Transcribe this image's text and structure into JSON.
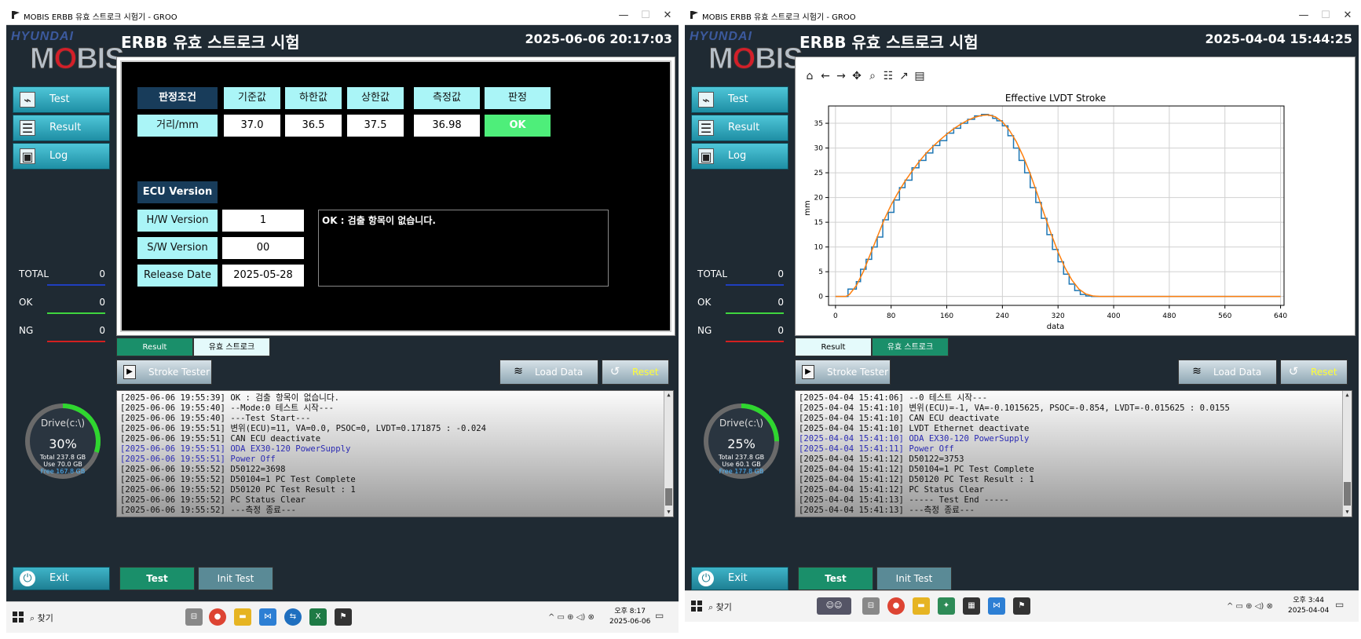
{
  "window_title": "MOBIS ERBB 유효 스트로크 시험기 - GROO",
  "window_controls": {
    "minimize": "—",
    "maximize": "☐",
    "close": "✕"
  },
  "logo": {
    "top": "HYUNDAI",
    "main_pre": "M",
    "main_o": "O",
    "main_post": "BIS"
  },
  "nav": {
    "test": "Test",
    "result": "Result",
    "log": "Log",
    "exit": "Exit"
  },
  "counters": {
    "total_label": "TOTAL",
    "ok_label": "OK",
    "ng_label": "NG",
    "colors": {
      "total": "#1f3fbf",
      "ok": "#3fd63f",
      "ng": "#d32020"
    }
  },
  "buttons": {
    "stroke_tester": "Stroke Tester",
    "load_data": "Load Data",
    "reset": "Reset",
    "init_test": "Init Test",
    "test": "Test"
  },
  "tabs": {
    "result": "Result",
    "stroke": "유효 스트로크"
  },
  "taskbar": {
    "search": "찾기"
  },
  "windows": [
    {
      "header_title": "ERBB 유효 스트로크 시험",
      "header_date": "2025-06-06 20:17:03",
      "counters": {
        "total": "0",
        "ok": "0",
        "ng": "0"
      },
      "drive": {
        "label": "Drive(c:\\)",
        "percent_text": "30%",
        "percent": 30,
        "total": "Total 237.8 GB",
        "use": "Use 70.0 GB",
        "free": "Free 167.8 GB"
      },
      "judge": {
        "headers": [
          "판정조건",
          "기준값",
          "하한값",
          "상한값",
          "측정값",
          "판정"
        ],
        "row_label": "거리/mm",
        "values": [
          "37.0",
          "36.5",
          "37.5",
          "36.98",
          "OK"
        ]
      },
      "ecu": {
        "title": "ECU Version",
        "hw_label": "H/W Version",
        "hw_value": "1",
        "sw_label": "S/W Version",
        "sw_value": "00",
        "release_label": "Release Date",
        "release_value": "2025-05-28"
      },
      "message": "OK : 검출 항목이 없습니다.",
      "active_tab": "result",
      "log": [
        {
          "text": "[2025-06-06 19:55:39] OK : 검출 항목이 없습니다.",
          "color": "black"
        },
        {
          "text": "[2025-06-06 19:55:40] --Mode:0 테스트 시작---",
          "color": "black"
        },
        {
          "text": "[2025-06-06 19:55:40] ---Test Start---",
          "color": "black"
        },
        {
          "text": "[2025-06-06 19:55:51] 변위(ECU)=11, VA=0.0, PSOC=0, LVDT=0.171875 : -0.024",
          "color": "black"
        },
        {
          "text": "[2025-06-06 19:55:51] CAN ECU deactivate",
          "color": "black"
        },
        {
          "text": "[2025-06-06 19:55:51] ODA EX30-120 PowerSupply",
          "color": "blue"
        },
        {
          "text": "[2025-06-06 19:55:51] Power Off",
          "color": "blue"
        },
        {
          "text": "[2025-06-06 19:55:52] D50122=3698",
          "color": "black"
        },
        {
          "text": "[2025-06-06 19:55:52] D50104=1 PC Test Complete",
          "color": "black"
        },
        {
          "text": "[2025-06-06 19:55:52] D50120 PC Test Result : 1",
          "color": "black"
        },
        {
          "text": "[2025-06-06 19:55:52] PC Status Clear",
          "color": "black"
        },
        {
          "text": "[2025-06-06 19:55:52] ---측정 종료---",
          "color": "black"
        }
      ],
      "clock": {
        "time": "오후 8:17",
        "date": "2025-06-06"
      }
    },
    {
      "header_title": "ERBB 유효 스트로크 시험",
      "header_date": "2025-04-04 15:44:25",
      "counters": {
        "total": "0",
        "ok": "0",
        "ng": "0"
      },
      "drive": {
        "label": "Drive(c:\\)",
        "percent_text": "25%",
        "percent": 25,
        "total": "Total 237.8 GB",
        "use": "Use 60.1 GB",
        "free": "Free 177.8 GB"
      },
      "active_tab": "stroke",
      "log": [
        {
          "text": "[2025-04-04 15:41:06] --0 테스트 시작---",
          "color": "black"
        },
        {
          "text": "[2025-04-04 15:41:10] 변위(ECU)=-1, VA=-0.1015625, PSOC=-0.854, LVDT=-0.015625 : 0.0155",
          "color": "black"
        },
        {
          "text": "[2025-04-04 15:41:10] CAN ECU deactivate",
          "color": "black"
        },
        {
          "text": "[2025-04-04 15:41:10] LVDT Ethernet deactivate",
          "color": "black"
        },
        {
          "text": "[2025-04-04 15:41:10] ODA EX30-120 PowerSupply",
          "color": "blue"
        },
        {
          "text": "[2025-04-04 15:41:11] Power Off",
          "color": "blue"
        },
        {
          "text": "[2025-04-04 15:41:12] D50122=3753",
          "color": "black"
        },
        {
          "text": "[2025-04-04 15:41:12] D50104=1 PC Test Complete",
          "color": "black"
        },
        {
          "text": "[2025-04-04 15:41:12] D50120 PC Test Result : 1",
          "color": "black"
        },
        {
          "text": "[2025-04-04 15:41:12] PC Status Clear",
          "color": "black"
        },
        {
          "text": "[2025-04-04 15:41:13] ----- Test End -----",
          "color": "black"
        },
        {
          "text": "[2025-04-04 15:41:13] ---측정 종료---",
          "color": "black"
        }
      ],
      "clock": {
        "time": "오후 3:44",
        "date": "2025-04-04"
      }
    }
  ],
  "chart_data": {
    "type": "line",
    "title": "Effective LVDT Stroke",
    "xlabel": "data",
    "ylabel": "mm",
    "xlim": [
      -10,
      645
    ],
    "ylim": [
      -1.8,
      38.5
    ],
    "xticks": [
      0,
      80,
      160,
      240,
      320,
      400,
      480,
      560,
      640
    ],
    "yticks": [
      0,
      5,
      10,
      15,
      20,
      25,
      30,
      35
    ],
    "grid": true,
    "series": [
      {
        "color": "#1f77b4",
        "step": true,
        "x": [
          0,
          12,
          18,
          24,
          30,
          36,
          44,
          52,
          60,
          68,
          76,
          84,
          92,
          100,
          110,
          120,
          130,
          140,
          150,
          160,
          170,
          180,
          190,
          200,
          210,
          220,
          226,
          232,
          240,
          248,
          256,
          264,
          272,
          280,
          288,
          296,
          304,
          312,
          320,
          328,
          336,
          344,
          352,
          360,
          368,
          376,
          384,
          392,
          400,
          640
        ],
        "y": [
          0,
          0,
          1.5,
          1.5,
          3,
          5.5,
          7.5,
          10,
          12,
          15.5,
          17,
          19.5,
          22,
          23.5,
          26,
          27.5,
          29,
          30.5,
          31.5,
          33,
          34,
          35,
          35.8,
          36.5,
          36.8,
          36.6,
          36,
          35.5,
          34.5,
          32.5,
          30,
          27.5,
          25,
          22,
          19,
          15.8,
          12.5,
          9.5,
          7,
          4.5,
          2.5,
          1.2,
          0.4,
          0.1,
          0,
          0,
          0,
          0,
          0,
          0
        ]
      },
      {
        "color": "#ff7f0e",
        "step": false,
        "x": [
          0,
          15,
          20,
          30,
          40,
          50,
          60,
          70,
          80,
          90,
          100,
          110,
          120,
          130,
          140,
          150,
          160,
          170,
          180,
          190,
          200,
          210,
          220,
          230,
          240,
          250,
          260,
          270,
          280,
          290,
          300,
          310,
          320,
          330,
          340,
          350,
          360,
          370,
          380,
          390,
          400,
          640
        ],
        "y": [
          0,
          0,
          0.4,
          2.2,
          5,
          8.5,
          12,
          15.5,
          18.5,
          21,
          23.3,
          25.3,
          27.2,
          28.9,
          30.3,
          31.6,
          32.8,
          33.9,
          34.8,
          35.6,
          36.2,
          36.6,
          36.7,
          36.3,
          35.3,
          33.6,
          31.3,
          28.3,
          24.8,
          20.8,
          16.7,
          12.7,
          9,
          5.8,
          3.3,
          1.5,
          0.5,
          0.1,
          0,
          0,
          0,
          0
        ]
      }
    ]
  }
}
